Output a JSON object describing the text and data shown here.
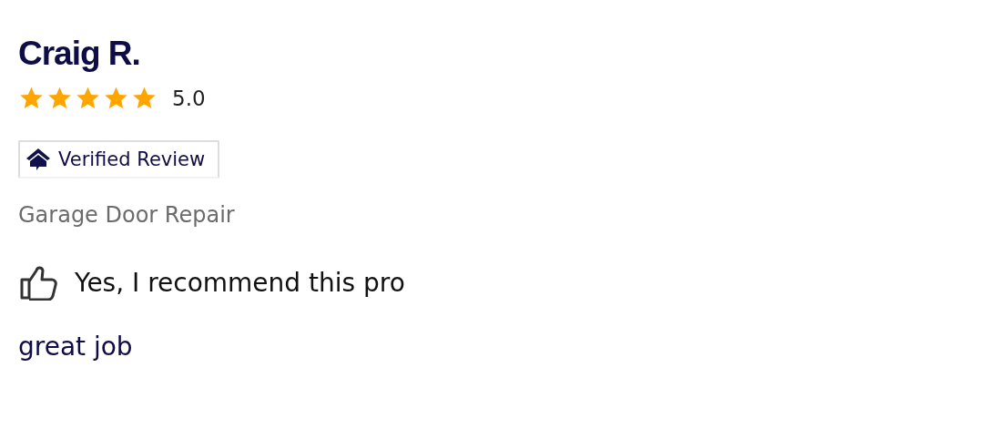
{
  "review": {
    "author": "Craig R.",
    "stars": 5,
    "rating": "5.0",
    "badge": "Verified Review",
    "service": "Garage Door Repair",
    "recommended": true,
    "recommendation": "Yes, I recommend this pro",
    "comment": "great job"
  }
}
